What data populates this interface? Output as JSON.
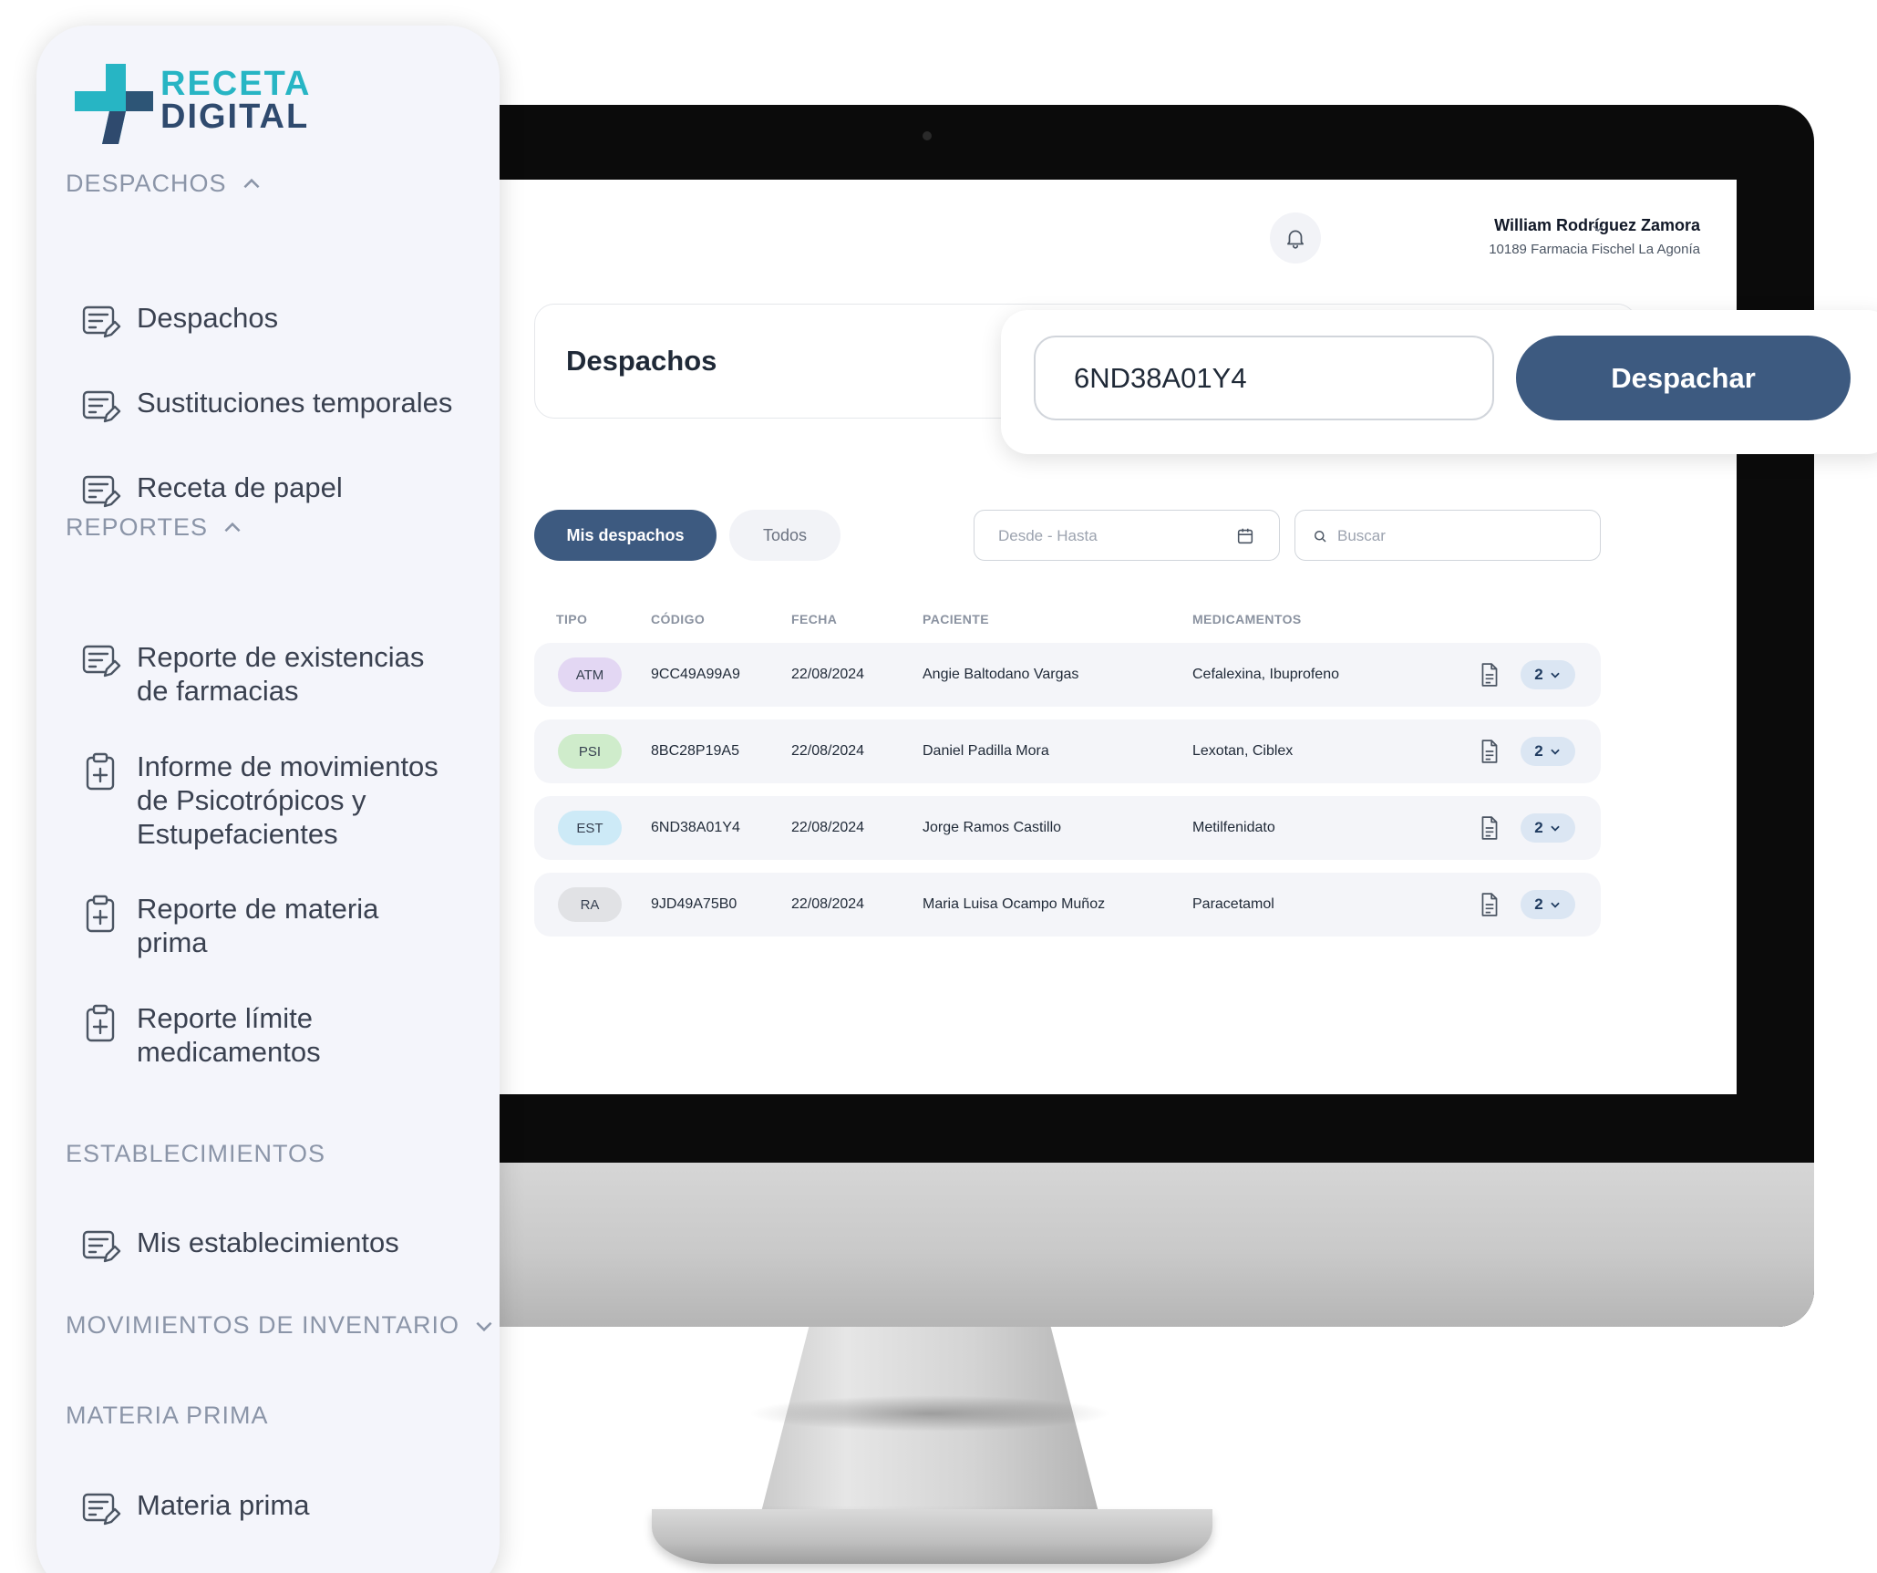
{
  "app": {
    "logo_line1": "RECETA",
    "logo_line2": "DIGITAL",
    "colors": {
      "primary": "#3d5a80",
      "accent": "#27b5c4",
      "navy": "#2f4a6e"
    }
  },
  "sidebar": {
    "sections": [
      {
        "title": "DESPACHOS",
        "expanded": true,
        "items": [
          "Despachos",
          "Sustituciones temporales",
          "Receta de papel"
        ]
      },
      {
        "title": "REPORTES",
        "expanded": true,
        "items": [
          "Reporte de existencias de farmacias",
          "Informe de movimientos de Psicotrópicos y Estupefacientes",
          "Reporte de materia prima",
          "Reporte límite medicamentos"
        ]
      },
      {
        "title": "ESTABLECIMIENTOS",
        "items": [
          "Mis establecimientos"
        ]
      },
      {
        "title": "MOVIMIENTOS DE INVENTARIO",
        "expanded": false,
        "items": []
      },
      {
        "title": "MATERIA PRIMA",
        "items": [
          "Materia prima"
        ]
      }
    ]
  },
  "header": {
    "user_name": "William Rodríguez Zamora",
    "user_org": "10189 Farmacia Fischel La Agonía"
  },
  "main": {
    "page_title": "Despachos",
    "dispatch": {
      "code_value": "6ND38A01Y4",
      "button_label": "Despachar"
    },
    "tabs": [
      {
        "label": "Mis despachos",
        "active": true
      },
      {
        "label": "Todos",
        "active": false
      }
    ],
    "date_placeholder": "Desde - Hasta",
    "search_placeholder": "Buscar",
    "table": {
      "headers": [
        "TIPO",
        "CÓDIGO",
        "FECHA",
        "PACIENTE",
        "MEDICAMENTOS"
      ],
      "rows": [
        {
          "tipo": "ATM",
          "tipo_color": "#e3d7f3",
          "codigo": "9CC49A99A9",
          "fecha": "22/08/2024",
          "paciente": "Angie Baltodano Vargas",
          "medicamentos": "Cefalexina, Ibuprofeno",
          "count": "2"
        },
        {
          "tipo": "PSI",
          "tipo_color": "#cfeccb",
          "codigo": "8BC28P19A5",
          "fecha": "22/08/2024",
          "paciente": "Daniel Padilla Mora",
          "medicamentos": "Lexotan, Ciblex",
          "count": "2"
        },
        {
          "tipo": "EST",
          "tipo_color": "#cdeaf7",
          "codigo": "6ND38A01Y4",
          "fecha": "22/08/2024",
          "paciente": "Jorge Ramos Castillo",
          "medicamentos": "Metilfenidato",
          "count": "2"
        },
        {
          "tipo": "RA",
          "tipo_color": "#e1e2e5",
          "codigo": "9JD49A75B0",
          "fecha": "22/08/2024",
          "paciente": "Maria Luisa Ocampo Muñoz",
          "medicamentos": "Paracetamol",
          "count": "2"
        }
      ]
    }
  }
}
